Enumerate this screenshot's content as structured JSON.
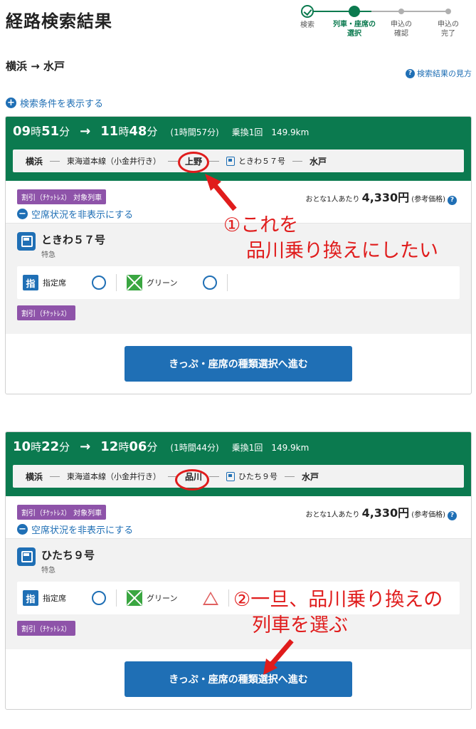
{
  "page_title": "経路検索結果",
  "stepper": [
    {
      "label": "検索",
      "state": "done"
    },
    {
      "label": "列車・座席の\n選択",
      "state": "current"
    },
    {
      "label": "申込の\n確認",
      "state": "future"
    },
    {
      "label": "申込の\n完了",
      "state": "future"
    }
  ],
  "route": "横浜 → 水戸",
  "help_link": "検索結果の見方",
  "show_conditions": "検索条件を表示する",
  "results": [
    {
      "dep_h": "09",
      "dep_m": "51",
      "arr_h": "11",
      "arr_m": "48",
      "duration": "(1時間57分)",
      "transfers": "乗換1回",
      "distance": "149.9km",
      "from": "横浜",
      "line": "東海道本線（小金井行き）",
      "via": "上野",
      "ltd": "ときわ５７号",
      "to": "水戸",
      "discount_badge": "割引（ﾁｹｯﾄﾚｽ） 対象列車",
      "price_prefix": "おとな1人あたり",
      "price": "4,330円",
      "price_suffix": "(参考価格)",
      "vacancy_toggle": "空席状況を非表示にする",
      "train_name": "ときわ５７号",
      "train_type": "特急",
      "reserved_label": "指定席",
      "green_label": "グリーン",
      "discount_label": "割引（ﾁｹｯﾄﾚｽ）",
      "cta": "きっぷ・座席の種類選択へ進む",
      "green_availability": "circle"
    },
    {
      "dep_h": "10",
      "dep_m": "22",
      "arr_h": "12",
      "arr_m": "06",
      "duration": "(1時間44分)",
      "transfers": "乗換1回",
      "distance": "149.9km",
      "from": "横浜",
      "line": "東海道本線（小金井行き）",
      "via": "品川",
      "ltd": "ひたち９号",
      "to": "水戸",
      "discount_badge": "割引（ﾁｹｯﾄﾚｽ） 対象列車",
      "price_prefix": "おとな1人あたり",
      "price": "4,330円",
      "price_suffix": "(参考価格)",
      "vacancy_toggle": "空席状況を非表示にする",
      "train_name": "ひたち９号",
      "train_type": "特急",
      "reserved_label": "指定席",
      "green_label": "グリーン",
      "discount_label": "割引（ﾁｹｯﾄﾚｽ）",
      "cta": "きっぷ・座席の種類選択へ進む",
      "green_availability": "triangle"
    }
  ],
  "annotations": {
    "note1_line1": "①これを",
    "note1_line2": "品川乗り換えにしたい",
    "note2_line1": "②一旦、品川乗り換えの",
    "note2_line2": "列車を選ぶ",
    "color": "#e01c1c"
  },
  "colors": {
    "header_green": "#0b7a4f",
    "link_blue": "#1f6fb5",
    "badge_purple": "#8e53a9"
  },
  "time_units": {
    "hour": "時",
    "minute": "分"
  },
  "arrow": "→"
}
